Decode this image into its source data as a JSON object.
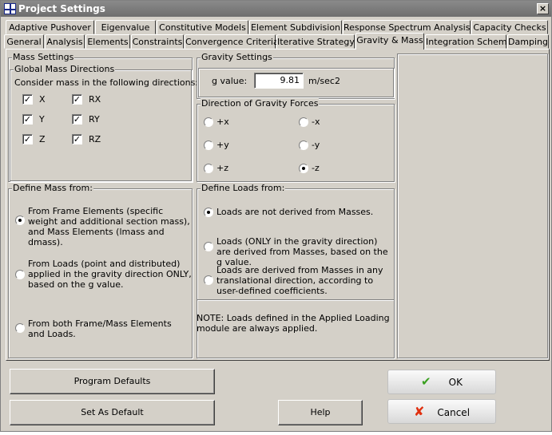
{
  "window": {
    "title": "Project Settings",
    "close": "×"
  },
  "tabs_row1": [
    "Adaptive Pushover",
    "Eigenvalue",
    "Constitutive Models",
    "Element Subdivision",
    "Response Spectrum Analysis",
    "Capacity Checks"
  ],
  "tabs_row2": [
    "General",
    "Analysis",
    "Elements",
    "Constraints",
    "Convergence Criteria",
    "Iterative Strategy",
    "Gravity & Mass",
    "Integration Scheme",
    "Damping"
  ],
  "active_tab": "Gravity & Mass",
  "mass_settings": {
    "title": "Mass Settings",
    "global_title": "Global Mass Directions",
    "prompt": "Consider mass in the following directions:",
    "directions": [
      {
        "label": "X",
        "checked": true
      },
      {
        "label": "RX",
        "checked": true
      },
      {
        "label": "Y",
        "checked": true
      },
      {
        "label": "RY",
        "checked": true
      },
      {
        "label": "Z",
        "checked": true
      },
      {
        "label": "RZ",
        "checked": true
      }
    ]
  },
  "define_mass": {
    "title": "Define Mass from:",
    "options": [
      {
        "label": "From Frame Elements (specific weight and additional section mass), and Mass Elements (lmass and dmass).",
        "selected": true
      },
      {
        "label": "From Loads (point and distributed) applied in the gravity direction ONLY, based on the g value.",
        "selected": false
      },
      {
        "label": "From both Frame/Mass Elements and Loads.",
        "selected": false
      }
    ]
  },
  "gravity": {
    "title": "Gravity Settings",
    "g_label": "g value:",
    "g_value": "9.81",
    "unit": "m/sec2"
  },
  "direction": {
    "title": "Direction of Gravity Forces",
    "options": [
      {
        "label": "+x",
        "selected": false
      },
      {
        "label": "-x",
        "selected": false
      },
      {
        "label": "+y",
        "selected": false
      },
      {
        "label": "-y",
        "selected": false
      },
      {
        "label": "+z",
        "selected": false
      },
      {
        "label": "-z",
        "selected": true
      }
    ]
  },
  "define_loads": {
    "title": "Define Loads from:",
    "options": [
      {
        "label": "Loads are not derived from Masses.",
        "selected": true
      },
      {
        "label": "Loads (ONLY in the gravity direction) are derived from Masses, based on the g value.",
        "selected": false
      },
      {
        "label": "Loads are derived from Masses in any translational direction, according to user-defined coefficients.",
        "selected": false
      }
    ],
    "note": "NOTE: Loads defined in the Applied Loading module are always applied."
  },
  "buttons": {
    "program_defaults": "Program Defaults",
    "set_as_default": "Set As Default",
    "help": "Help",
    "ok": "OK",
    "cancel": "Cancel"
  },
  "colors": {
    "ok_icon": "#3aa020",
    "cancel_icon": "#e03010"
  }
}
